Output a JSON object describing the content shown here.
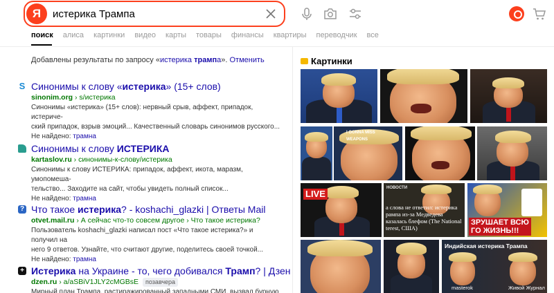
{
  "search": {
    "logo_letter": "Я",
    "query": "истерика Трампа"
  },
  "icons": {
    "clear": "close-icon",
    "voice": "microphone-icon",
    "camera": "camera-icon",
    "filters": "filter-icon",
    "user": "user-avatar-icon",
    "cart": "cart-icon"
  },
  "tabs": [
    {
      "label": "поиск",
      "active": true
    },
    {
      "label": "алиса"
    },
    {
      "label": "картинки"
    },
    {
      "label": "видео"
    },
    {
      "label": "карты"
    },
    {
      "label": "товары"
    },
    {
      "label": "финансы"
    },
    {
      "label": "квартиры"
    },
    {
      "label": "переводчик"
    },
    {
      "label": "все"
    }
  ],
  "notice": {
    "prefix": "Добавлены результаты по запросу «",
    "query_a": "истерика ",
    "query_b": "трамп",
    "query_c": "а",
    "suffix": "». ",
    "cancel": "Отменить"
  },
  "results": [
    {
      "favicon": "S",
      "favicon_color": "#1a8ad4",
      "title_a": "Синонимы к слову «",
      "title_b": "истерика",
      "title_c": "» (15+ слов)",
      "domain": "sinonim.org",
      "path": " › s/истерика",
      "snippet_line1": "Синонимы «истерика» (15+ слов): нервный срыв, аффект, припадок, истериче-",
      "snippet_line2": "ский припадок, взрыв эмоций... Качественный словарь синонимов русского...",
      "missing_label": "Не найдено: ",
      "missing_term": "трамна"
    },
    {
      "favicon": "",
      "favicon_color": "#2a9d8f",
      "title_a": "Синонимы к слову ",
      "title_b": "ИСТЕРИКА",
      "title_c": "",
      "domain": "kartaslov.ru",
      "path": " › синонимы-к-слову/истерика",
      "snippet_line1": "Синонимы к слову ИСТЕРИКА: припадок, аффект, икота, маразм, умопомеша-",
      "snippet_line2": "тельство... Заходите на сайт, чтобы увидеть полный список...",
      "missing_label": "Не найдено: ",
      "missing_term": "трамна"
    },
    {
      "favicon": "?",
      "favicon_color": "#2b66c4",
      "title_a": "Что такое ",
      "title_b": "истерика",
      "title_c": "? - koshachi_glazki | Ответы Mail",
      "domain": "otvet.mail.ru",
      "path": " › А сейчас что-то совсем другое › Что такое истерика?",
      "snippet_line1": "Пользователь koshachi_glazki написал пост «Что такое истерика?» и получил на",
      "snippet_line2": "него 9 ответов. Узнайте, что считают другие, поделитесь своей точкой...",
      "missing_label": "Не найдено: ",
      "missing_term": "трамна"
    },
    {
      "favicon": "+",
      "favicon_color": "#111111",
      "title_a": "",
      "title_b": "Истерика",
      "title_c": " на Украине - то, чего добивался ",
      "title_d": "Трамп",
      "title_e": "? | Дзен",
      "domain": "dzen.ru",
      "path": " › a/aSBiV1JLY2cMGBsE",
      "badge": "позавчера",
      "snippet_line1": "Мирный план Трампа, растиражированный западными СМИ, вызвал бурную ре-"
    }
  ],
  "images_panel": {
    "title": "Картинки",
    "live_tag": "LIVE",
    "caption_gonna": "I GONNA MISS\nWEAPONS",
    "overlay_3": "НОВОСТИ",
    "caption_news": "а слова не ответил: истерика\nрампа из-за Медведева\nказалась блефом (The National\nterest, США)",
    "caption_big": "ЗРУШАЕТ ВСЮ\nГО ЖИЗНЬ!!!",
    "overlay_indian": "Индийская истерика Трампа",
    "corner_a": "masterok",
    "corner_b": "Живой Журнал"
  }
}
